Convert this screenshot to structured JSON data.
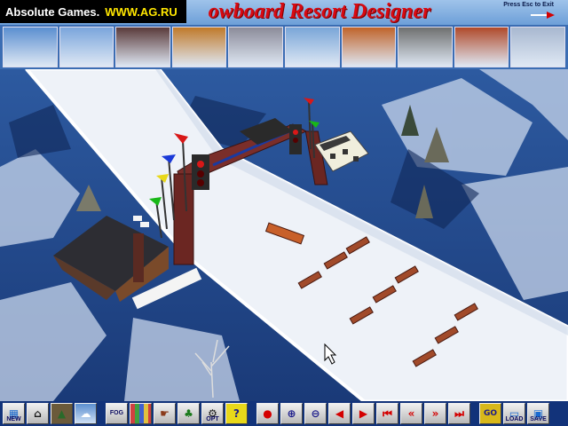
{
  "banner": {
    "site_name": "Absolute Games.",
    "site_url": "WWW.AG.RU",
    "title": "owboard Resort Designer",
    "exit_hint": "Press Esc to Exit"
  },
  "sky_presets": [
    {
      "name": "clear-blue",
      "color": "#5b8fd0"
    },
    {
      "name": "high-clouds",
      "color": "#7aa5dc"
    },
    {
      "name": "dusk-dark",
      "color": "#5a3a3a"
    },
    {
      "name": "sunset-gold",
      "color": "#c07a2a"
    },
    {
      "name": "grey-overcast",
      "color": "#8c8c9a"
    },
    {
      "name": "cumulus",
      "color": "#7aa6d8"
    },
    {
      "name": "orange-haze",
      "color": "#c0642a"
    },
    {
      "name": "storm-grey",
      "color": "#6f7070"
    },
    {
      "name": "red-sunset",
      "color": "#b04a2a"
    },
    {
      "name": "white-clouds",
      "color": "#a8b8d0"
    }
  ],
  "toolbar": {
    "new": "NEW",
    "fog": "FOG",
    "opt": "OPT",
    "help": "?",
    "go": "GO",
    "load": "LOAD",
    "save": "SAVE"
  },
  "colors": {
    "snow": "#eef2f8",
    "terrain": "#1c3f7a",
    "arch": "#7a2e2a",
    "toolbar": "#12337a"
  }
}
